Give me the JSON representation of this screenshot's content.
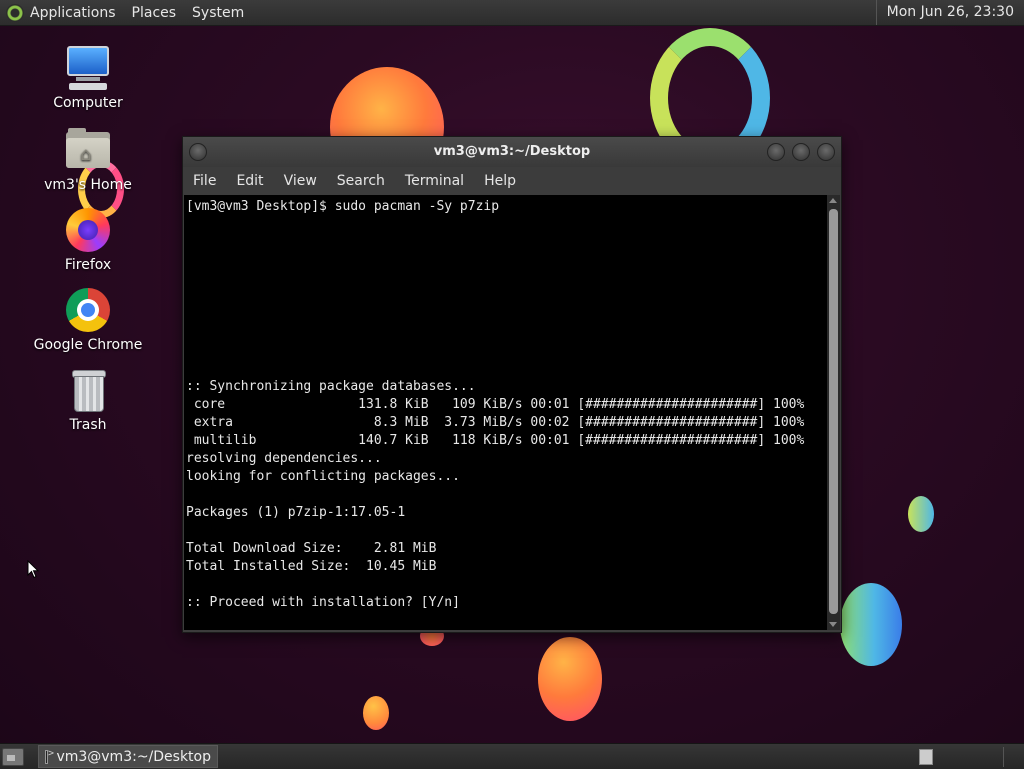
{
  "top_panel": {
    "menus": [
      "Applications",
      "Places",
      "System"
    ],
    "clock": "Mon Jun 26, 23:30"
  },
  "desktop_icons": [
    {
      "label": "Computer",
      "icon": "computer-icon"
    },
    {
      "label": "vm3's Home",
      "icon": "home-folder-icon"
    },
    {
      "label": "Firefox",
      "icon": "firefox-icon"
    },
    {
      "label": "Google Chrome",
      "icon": "chrome-icon"
    },
    {
      "label": "Trash",
      "icon": "trash-icon"
    }
  ],
  "terminal": {
    "title": "vm3@vm3:~/Desktop",
    "menu": [
      "File",
      "Edit",
      "View",
      "Search",
      "Terminal",
      "Help"
    ],
    "lines": [
      "[vm3@vm3 Desktop]$ sudo pacman -Sy p7zip",
      "",
      "",
      "",
      "",
      "",
      "",
      "",
      "",
      "",
      ":: Synchronizing package databases...",
      " core                 131.8 KiB   109 KiB/s 00:01 [######################] 100%",
      " extra                  8.3 MiB  3.73 MiB/s 00:02 [######################] 100%",
      " multilib             140.7 KiB   118 KiB/s 00:01 [######################] 100%",
      "resolving dependencies...",
      "looking for conflicting packages...",
      "",
      "Packages (1) p7zip-1:17.05-1",
      "",
      "Total Download Size:    2.81 MiB",
      "Total Installed Size:  10.45 MiB",
      "",
      ":: Proceed with installation? [Y/n]"
    ]
  },
  "bottom_panel": {
    "task": "vm3@vm3:~/Desktop"
  },
  "colors": {
    "panel": "#2c2c2c",
    "terminal_bg": "#000000",
    "terminal_fg": "#e8e8e8",
    "accent": "#8cc34a"
  }
}
